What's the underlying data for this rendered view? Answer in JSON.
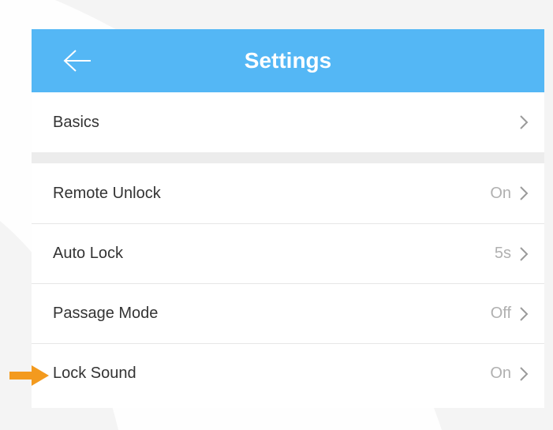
{
  "header": {
    "title": "Settings",
    "back_icon": "arrow-left-icon"
  },
  "sections": [
    {
      "items": [
        {
          "label": "Basics",
          "value": ""
        }
      ]
    },
    {
      "items": [
        {
          "label": "Remote Unlock",
          "value": "On"
        },
        {
          "label": "Auto Lock",
          "value": "5s"
        },
        {
          "label": "Passage Mode",
          "value": "Off"
        },
        {
          "label": "Lock Sound",
          "value": "On"
        }
      ]
    }
  ],
  "annotation": {
    "icon": "pointer-arrow-icon",
    "target": "Lock Sound",
    "color": "#f39a1e"
  },
  "colors": {
    "header_bg": "#54b7f5",
    "value_text": "#b0b0b0",
    "label_text": "#333333"
  }
}
